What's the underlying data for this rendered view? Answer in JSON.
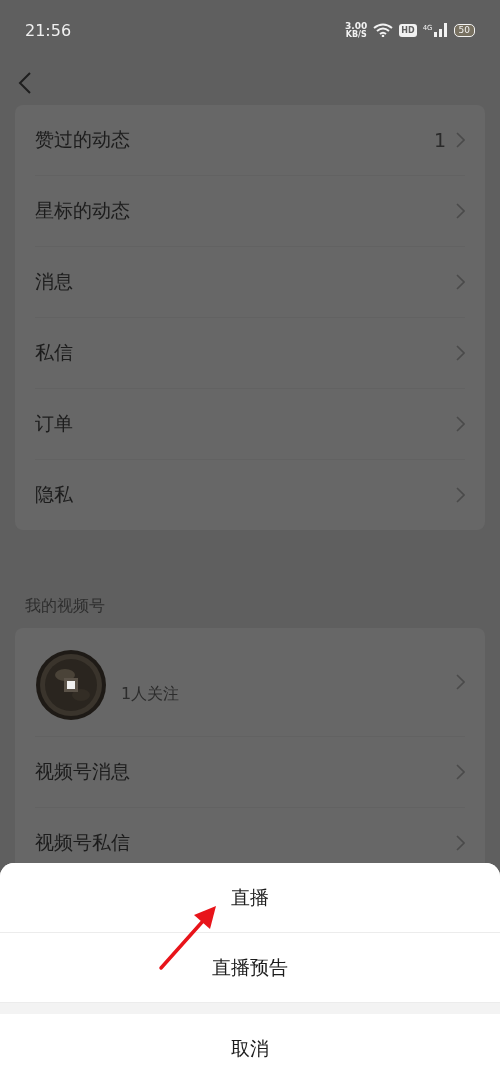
{
  "status_bar": {
    "time": "21:56",
    "speed": "3.00",
    "speed_unit": "KB/S",
    "hd_label": "HD",
    "network_label": "4G",
    "battery": "50"
  },
  "menu_items": [
    {
      "label": "赞过的动态",
      "count": "1"
    },
    {
      "label": "星标的动态"
    },
    {
      "label": "消息"
    },
    {
      "label": "私信"
    },
    {
      "label": "订单"
    },
    {
      "label": "隐私"
    }
  ],
  "section_title": "我的视频号",
  "channel": {
    "followers": "1人关注"
  },
  "channel_items": [
    {
      "label": "视频号消息"
    },
    {
      "label": "视频号私信"
    }
  ],
  "action_sheet": {
    "actions": [
      {
        "label": "直播"
      },
      {
        "label": "直播预告"
      }
    ],
    "cancel": "取消"
  }
}
